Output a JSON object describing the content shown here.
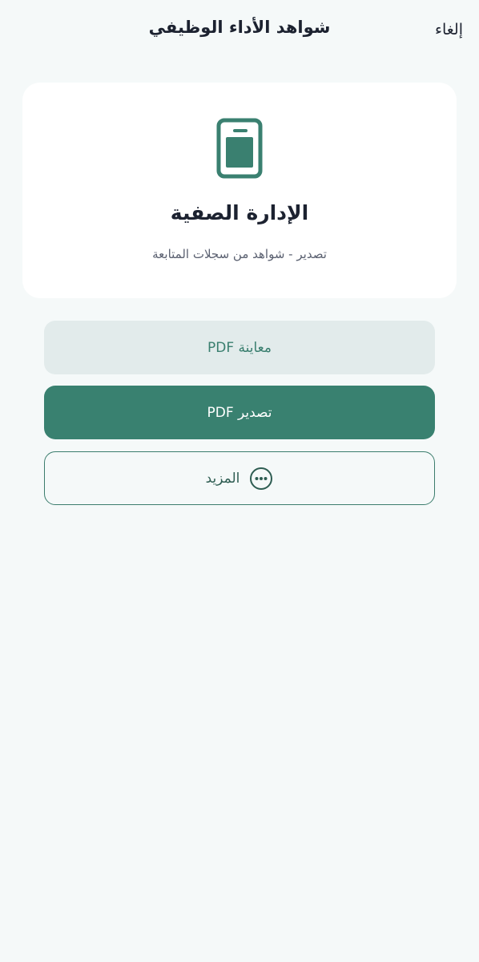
{
  "header": {
    "title": "شواهد الأداء الوظيفي",
    "cancel_label": "إلغاء"
  },
  "card": {
    "icon": "document-icon",
    "title": "الإدارة الصفية",
    "subtitle": "تصدير - شواهد من سجلات المتابعة"
  },
  "actions": {
    "preview_label": "معاينة PDF",
    "export_label": "تصدير PDF",
    "more_label": "المزيد",
    "more_icon": "ellipsis-circle-icon"
  },
  "colors": {
    "accent": "#398170",
    "preview_bg": "#e2ebeb",
    "page_bg": "#f5f9f9"
  }
}
